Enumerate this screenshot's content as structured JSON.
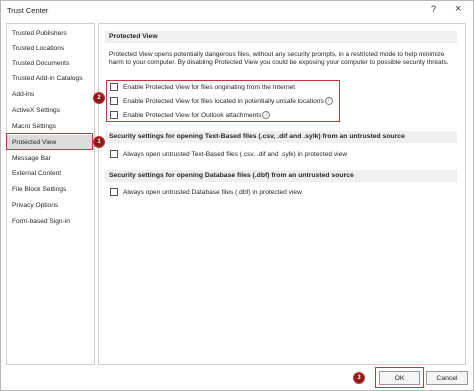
{
  "window": {
    "title": "Trust Center",
    "help_icon": "?",
    "close_icon": "×"
  },
  "sidebar": {
    "items": [
      {
        "label": "Trusted Publishers"
      },
      {
        "label": "Trusted Locations"
      },
      {
        "label": "Trusted Documents"
      },
      {
        "label": "Trusted Add-in Catalogs"
      },
      {
        "label": "Add-ins"
      },
      {
        "label": "ActiveX Settings"
      },
      {
        "label": "Macro Settings"
      },
      {
        "label": "Protected View"
      },
      {
        "label": "Message Bar"
      },
      {
        "label": "External Content"
      },
      {
        "label": "File Block Settings"
      },
      {
        "label": "Privacy Options"
      },
      {
        "label": "Form-based Sign-in"
      }
    ],
    "selected": "Protected View"
  },
  "protected_view": {
    "header": "Protected View",
    "description": "Protected View opens potentially dangerous files, without any security prompts, in a restricted mode to help minimize harm to your computer. By disabling Protected View you could be exposing your computer to possible security threats.",
    "options": [
      {
        "label": "Enable Protected View for files originating from the Internet",
        "checked": false
      },
      {
        "label": "Enable Protected View for files located in potentially unsafe locations",
        "checked": false,
        "info": "ⓘ"
      },
      {
        "label": "Enable Protected View for Outlook attachments",
        "checked": false,
        "info": "ⓘ"
      }
    ]
  },
  "text_based": {
    "header": "Security settings for opening Text-Based files (.csv, .dif and .sylk) from an untrusted source",
    "option": {
      "label": "Always open untrusted Text-Based files (.csv, .dif and .sylk) in protected view",
      "checked": false
    }
  },
  "database": {
    "header": "Security settings for opening Database files (.dbf) from an untrusted source",
    "option": {
      "label": "Always open untrusted Database files (.dbf) in protected view",
      "checked": false
    }
  },
  "badges": {
    "one": "1",
    "two": "2",
    "three": "3"
  },
  "buttons": {
    "ok": "OK",
    "cancel": "Cancel"
  },
  "colors": {
    "highlight": "#c8353c",
    "badge": "#8b1a1a",
    "selected_bg": "#dcdcdc",
    "section_bg": "#efefef"
  }
}
